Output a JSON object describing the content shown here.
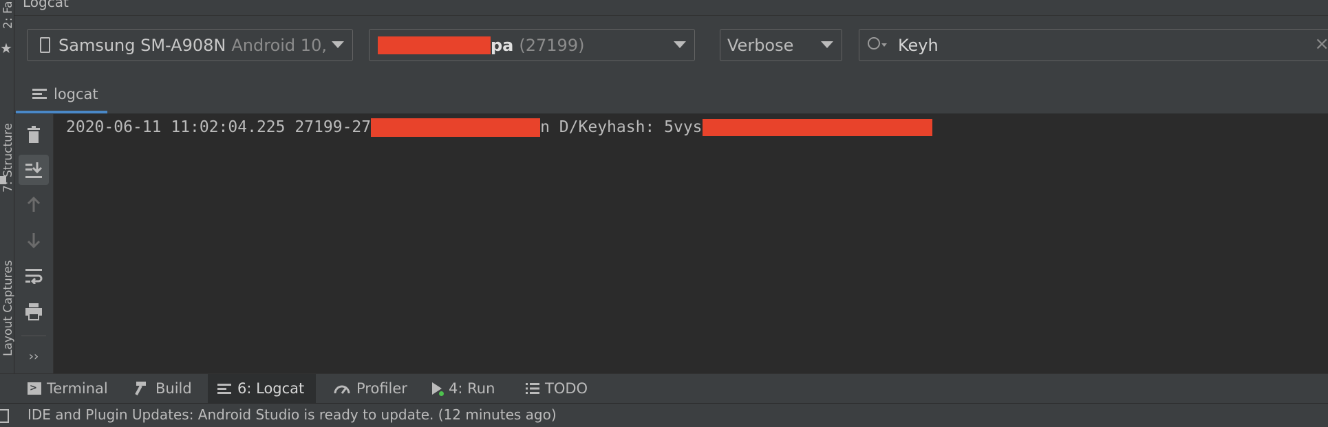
{
  "window": {
    "title": "Logcat"
  },
  "left_strip": {
    "tabs": [
      {
        "label": "2: Fa"
      },
      {
        "label": "7: Structure"
      },
      {
        "label": "Layout Captures"
      }
    ]
  },
  "toolbar": {
    "device": {
      "name": "Samsung SM-A908N",
      "os": "Android 10,"
    },
    "process": {
      "name_suffix": "pa",
      "pid": "(27199)"
    },
    "level": {
      "value": "Verbose"
    },
    "search": {
      "value": "Keyh"
    }
  },
  "logcat_tab": {
    "label": "logcat"
  },
  "log": {
    "lines": [
      {
        "prefix": "2020-06-11 11:02:04.225 27199-27",
        "middle": "n D/Keyhash: 5vys"
      }
    ]
  },
  "bottom_tabs": [
    {
      "label": "Terminal",
      "icon": "terminal-icon"
    },
    {
      "label": "Build",
      "icon": "hammer-icon"
    },
    {
      "label": "6: Logcat",
      "icon": "logcat-icon"
    },
    {
      "label": "Profiler",
      "icon": "gauge-icon"
    },
    {
      "label": "4: Run",
      "icon": "play-icon"
    },
    {
      "label": "TODO",
      "icon": "list-icon"
    }
  ],
  "status": {
    "message": "IDE and Plugin Updates: Android Studio is ready to update. (12 minutes ago)"
  },
  "colors": {
    "redaction": "#e8432b",
    "accent": "#4a88c7",
    "panel": "#3c3f41",
    "editor": "#2b2b2b"
  }
}
